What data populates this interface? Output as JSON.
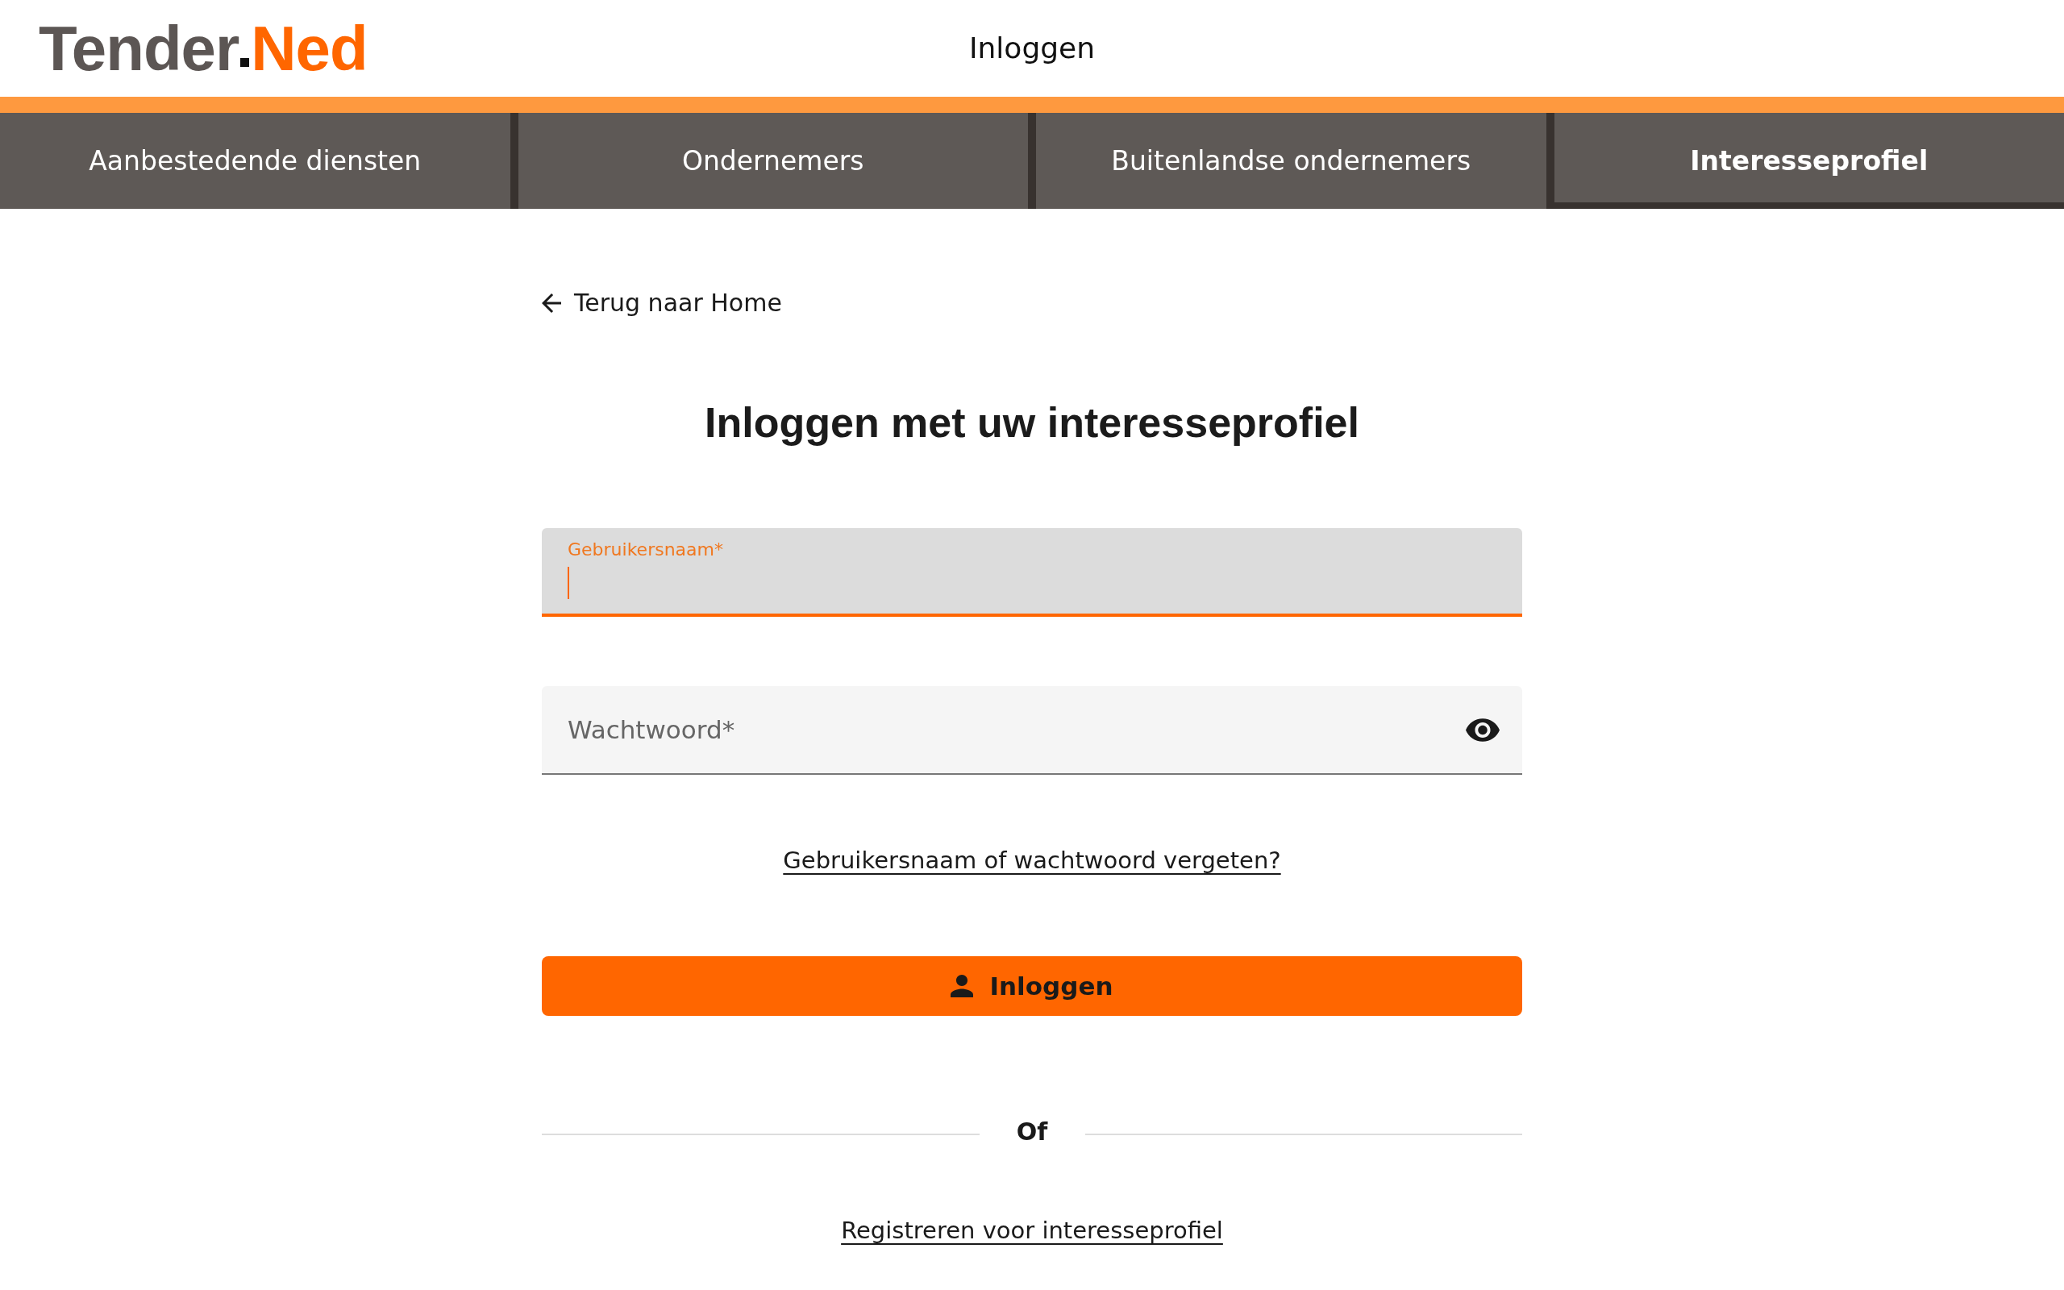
{
  "header": {
    "logo": {
      "first_part": "Tender",
      "second_part": "Ned"
    },
    "title": "Inloggen"
  },
  "nav": {
    "items": [
      {
        "label": "Aanbestedende diensten",
        "selected": false
      },
      {
        "label": "Ondernemers",
        "selected": false
      },
      {
        "label": "Buitenlandse ondernemers",
        "selected": false
      },
      {
        "label": "Interesseprofiel",
        "selected": true
      }
    ]
  },
  "back_link": "Terug naar Home",
  "heading": "Inloggen met uw interesseprofiel",
  "form": {
    "fields": [
      {
        "kind": "text",
        "label": "Gebruikersnaam*",
        "focused": true
      },
      {
        "kind": "password",
        "label": "Wachtwoord*",
        "focused": false
      }
    ],
    "forgot_link": "Gebruikersnaam of wachtwoord vergeten?",
    "submit_button": "Inloggen",
    "separator": "Of",
    "register_link": "Registreren voor interesseprofiel"
  }
}
